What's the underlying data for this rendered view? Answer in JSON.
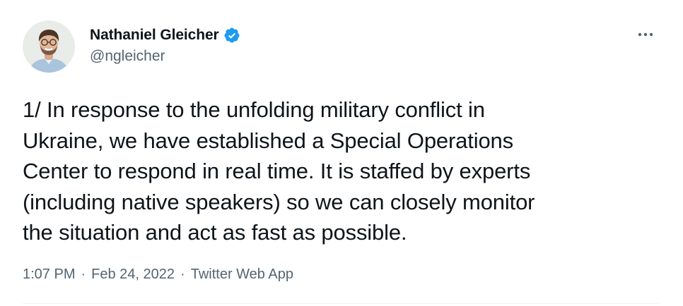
{
  "author": {
    "display_name": "Nathaniel Gleicher",
    "handle": "@ngleicher",
    "verified_icon": "verified-badge-icon",
    "verified_color": "#1d9bf0"
  },
  "more_icon": "more-horizontal-icon",
  "tweet": {
    "text": "1/ In response to the unfolding military conflict in\nUkraine, we have established a Special Operations\nCenter to respond in real time. It is staffed by experts\n(including native speakers) so we can closely monitor\nthe situation and act as fast as possible."
  },
  "meta": {
    "time": "1:07 PM",
    "separator": "·",
    "date": "Feb 24, 2022",
    "source": "Twitter Web App"
  },
  "colors": {
    "text_primary": "#0f1419",
    "text_secondary": "#536471",
    "divider": "#eff3f4"
  }
}
